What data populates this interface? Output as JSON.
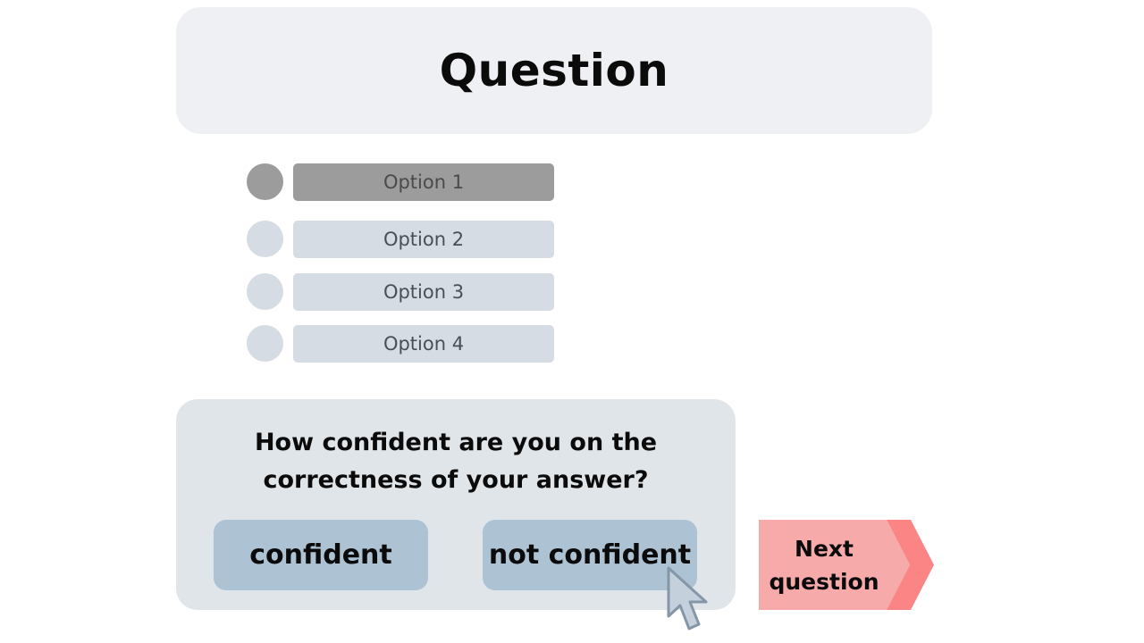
{
  "question": {
    "title": "Question"
  },
  "options": [
    {
      "label": "Option 1",
      "selected": true
    },
    {
      "label": "Option 2",
      "selected": false
    },
    {
      "label": "Option 3",
      "selected": false
    },
    {
      "label": "Option 4",
      "selected": false
    }
  ],
  "confidence": {
    "prompt_line1": "How confident are you on the",
    "prompt_line2": "correctness of your answer?",
    "confident_label": "confident",
    "not_confident_label": "not confident"
  },
  "next": {
    "line1": "Next",
    "line2": "question"
  },
  "colors": {
    "card_bg": "#eff0f3",
    "option_bg": "#d5dce3",
    "option_selected_bg": "#9c9c9c",
    "panel_bg": "#e0e5ea",
    "confidence_button_bg": "#adc2d3",
    "next_button_fill": "#f6aaaa",
    "next_button_arrow": "#fb8585"
  },
  "icons": {
    "cursor": "mouse-pointer-icon",
    "next_arrow": "chevron-right-arrow-icon"
  }
}
